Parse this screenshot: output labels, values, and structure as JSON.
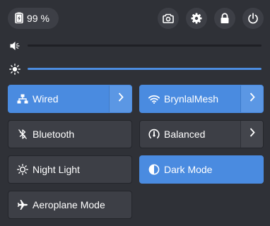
{
  "battery": {
    "percent_label": "99 %",
    "icon": "battery-charging-icon"
  },
  "header_buttons": [
    {
      "icon": "camera-icon",
      "name": "screenshot-button"
    },
    {
      "icon": "gear-icon",
      "name": "settings-button"
    },
    {
      "icon": "lock-icon",
      "name": "lock-button"
    },
    {
      "icon": "power-icon",
      "name": "power-button"
    }
  ],
  "volume": {
    "icon": "speaker-muted-icon",
    "level": 0.0
  },
  "brightness": {
    "icon": "sun-icon",
    "level": 1.0
  },
  "tiles": {
    "wired": {
      "label": "Wired",
      "active": true,
      "icon": "network-wired-icon",
      "has_menu": true
    },
    "wifi": {
      "label": "BrynlalMesh",
      "active": true,
      "icon": "wifi-icon",
      "has_menu": true
    },
    "bluetooth": {
      "label": "Bluetooth",
      "active": false,
      "icon": "bluetooth-disabled-icon",
      "has_menu": false
    },
    "power_mode": {
      "label": "Balanced",
      "active": false,
      "icon": "speedometer-icon",
      "has_menu": true
    },
    "night_light": {
      "label": "Night Light",
      "active": false,
      "icon": "night-light-icon",
      "has_menu": false
    },
    "dark_mode": {
      "label": "Dark Mode",
      "active": true,
      "icon": "dark-mode-icon",
      "has_menu": false
    },
    "aeroplane": {
      "label": "Aeroplane Mode",
      "active": false,
      "icon": "airplane-icon",
      "has_menu": false
    }
  },
  "colors": {
    "accent": "#4a8be0",
    "background": "#2f3137",
    "tile": "#3d3f46"
  }
}
